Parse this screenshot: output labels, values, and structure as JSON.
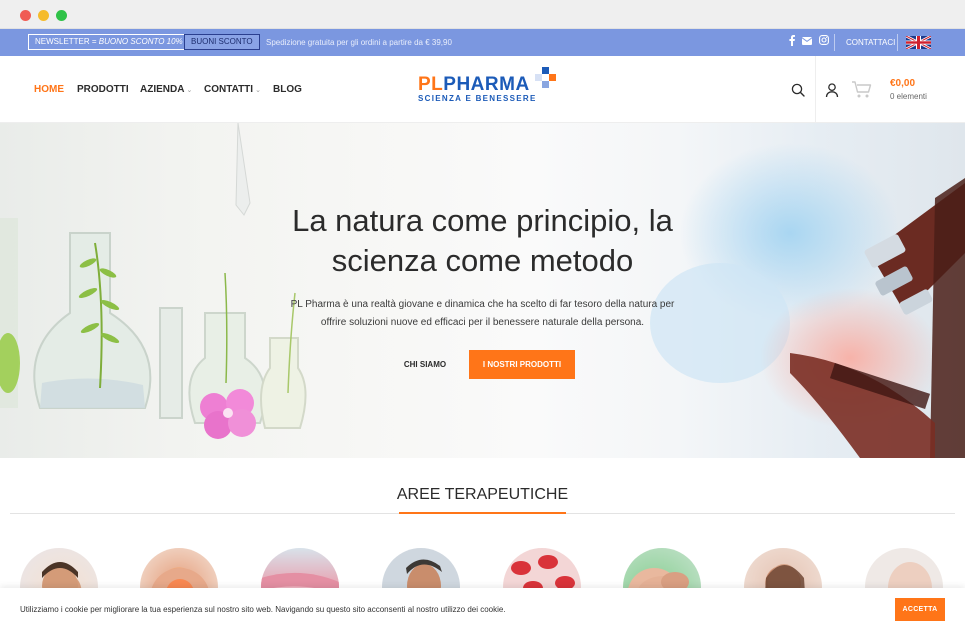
{
  "top_bar": {
    "newsletter_prefix": "NEWSLETTER = ",
    "newsletter_offer": "BUONO SCONTO 10%",
    "voucher_label": "BUONI SCONTO",
    "shipping_text": "Spedizione gratuita per gli ordini a partire da € 39,90",
    "social_icons": [
      "facebook-icon",
      "mail-icon",
      "instagram-icon"
    ],
    "contact_label": "CONTATTACI",
    "language_flag": "uk-flag-icon",
    "background_color": "#7b97e0"
  },
  "nav": {
    "items": [
      {
        "label": "HOME",
        "active": true,
        "dropdown": false
      },
      {
        "label": "PRODOTTI",
        "active": false,
        "dropdown": false
      },
      {
        "label": "AZIENDA",
        "active": false,
        "dropdown": true
      },
      {
        "label": "CONTATTI",
        "active": false,
        "dropdown": true
      },
      {
        "label": "BLOG",
        "active": false,
        "dropdown": false
      }
    ],
    "active_color": "#ff7518"
  },
  "logo": {
    "part1": "PL",
    "part2": "PHARMA",
    "tagline": "SCIENZA E BENESSERE",
    "color_orange": "#ff7518",
    "color_blue": "#1c5bb8"
  },
  "header_actions": {
    "search_icon": "search-icon",
    "account_icon": "user-icon",
    "cart_icon": "cart-icon",
    "cart_total": "€0,00",
    "cart_items": "0 elementi"
  },
  "hero": {
    "title_line1": "La natura come principio, la",
    "title_line2": "scienza come metodo",
    "text_line1": "PL Pharma è una realtà giovane e dinamica che ha scelto di far tesoro della natura per",
    "text_line2": "offrire soluzioni nuove ed efficaci per il benessere naturale della persona.",
    "secondary_button": "CHI SIAMO",
    "primary_button": "I NOSTRI PRODOTTI"
  },
  "therapeutic_areas": {
    "title": "AREE TERAPEUTICHE",
    "accent_color": "#ff7518",
    "circle_images": [
      "sleeping-man-image",
      "back-pain-image",
      "pink-skin-image",
      "man-profile-image",
      "red-cells-image",
      "hands-image",
      "woman-image",
      "skin-care-image"
    ]
  },
  "cookie_bar": {
    "text": "Utilizziamo i cookie per migliorare la tua esperienza sul nostro sito web. Navigando su questo sito acconsenti al nostro utilizzo dei cookie.",
    "accept_label": "ACCETTA"
  }
}
